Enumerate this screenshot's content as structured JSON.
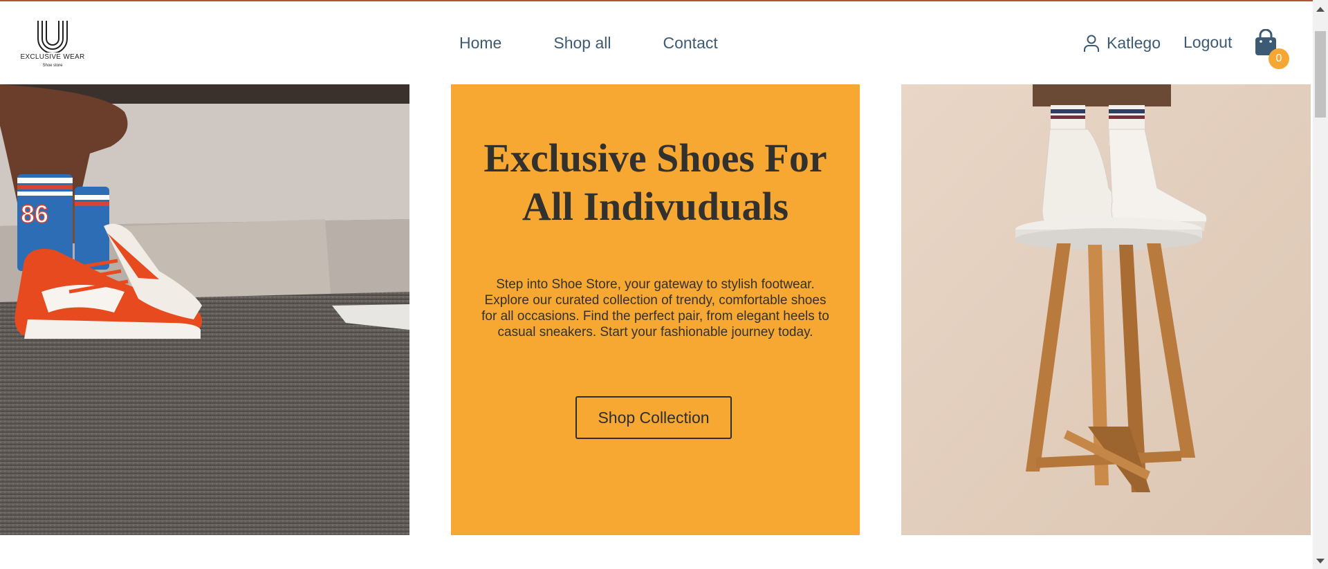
{
  "brand": {
    "name": "EXCLUSIVE WEAR",
    "tagline": "Shoe store"
  },
  "nav": {
    "items": [
      {
        "label": "Home"
      },
      {
        "label": "Shop all"
      },
      {
        "label": "Contact"
      }
    ]
  },
  "user": {
    "name": "Katlego",
    "logout_label": "Logout",
    "icon": "user-icon"
  },
  "cart": {
    "icon": "shopping-bag-icon",
    "count": "0",
    "badge_color": "#f6a733"
  },
  "hero": {
    "title_line1": "Exclusive Shoes For",
    "title_line2": "All Indivuduals",
    "description": "Step into Shoe Store, your gateway to stylish footwear. Explore our curated collection of trendy, comfortable shoes for all occasions. Find the perfect pair, from elegant heels to casual sneakers. Start your fashionable journey today.",
    "cta_label": "Shop Collection",
    "background_color": "#f6a833"
  },
  "colors": {
    "nav_text": "#3c5a73",
    "accent_top": "#b5523b",
    "hero_text": "#33312d"
  }
}
